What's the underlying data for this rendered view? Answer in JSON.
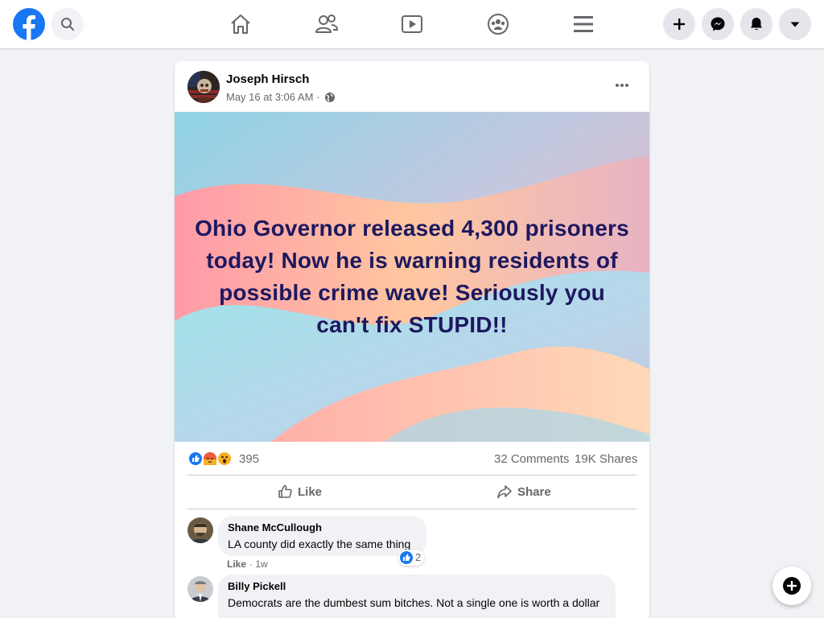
{
  "app": {
    "name": "Facebook",
    "accent": "#1877f2"
  },
  "topbar": {
    "icons": [
      "facebook-logo-icon",
      "search-icon",
      "home-icon",
      "friends-icon",
      "watch-icon",
      "groups-icon",
      "menu-icon",
      "create-icon",
      "messenger-icon",
      "notifications-icon",
      "account-dropdown-icon"
    ]
  },
  "post": {
    "author": "Joseph Hirsch",
    "timestamp": "May 16 at 3:06 AM",
    "separator": "·",
    "privacy_icon": "globe-icon",
    "image_text": "Ohio Governor released 4,300 prisoners today! Now he is warning residents of possible crime wave! Seriously you can't fix STUPID!!",
    "image_text_color": "#1d1860",
    "reactions": {
      "types": [
        "like",
        "angry",
        "wow"
      ],
      "count": "395"
    },
    "comments_count": "32 Comments",
    "shares_count": "19K Shares",
    "actions": {
      "like": "Like",
      "share": "Share"
    }
  },
  "comments": [
    {
      "name": "Shane McCullough",
      "text": "LA county did exactly the same thing",
      "like_label": "Like",
      "time": "1w",
      "reaction_count": "2"
    },
    {
      "name": "Billy Pickell",
      "text": "Democrats are the dumbest sum bitches. Not a single one is worth a dollar"
    }
  ],
  "fab": {
    "icon": "new-message-icon"
  }
}
